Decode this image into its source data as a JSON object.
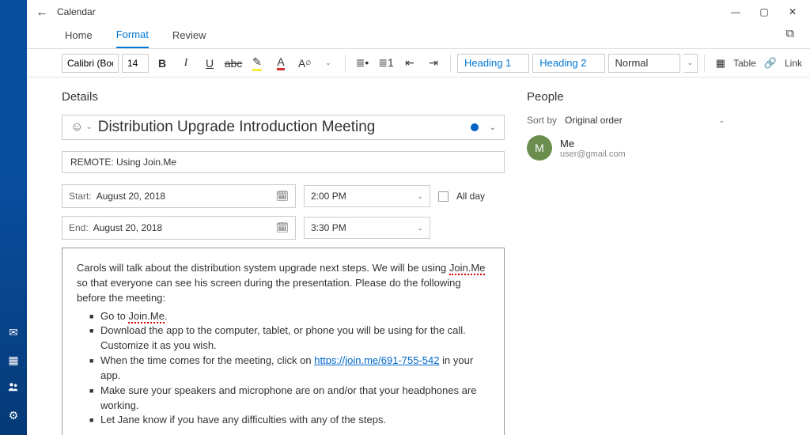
{
  "window": {
    "app_title": "Calendar"
  },
  "sidebar_icons": [
    "mail-icon",
    "calendar-icon",
    "people-icon",
    "settings-icon"
  ],
  "ribbon": {
    "tabs": [
      "Home",
      "Format",
      "Review"
    ],
    "active_tab": 1,
    "font_name": "Calibri (Body)",
    "font_size": "14",
    "heading1": "Heading 1",
    "heading2": "Heading 2",
    "normal": "Normal",
    "table_label": "Table",
    "link_label": "Link"
  },
  "details": {
    "section_label": "Details",
    "event_title": "Distribution Upgrade Introduction Meeting",
    "location": "REMOTE: Using Join.Me",
    "start_label": "Start:",
    "start_date": "August 20, 2018",
    "start_time": "2:00 PM",
    "all_day_label": "All day",
    "end_label": "End:",
    "end_date": "August 20, 2018",
    "end_time": "3:30 PM",
    "body_intro_1": "Carols will talk about the distribution system upgrade next steps. We will be using ",
    "body_intro_joinme": "Join.Me",
    "body_intro_2": " so that everyone can see his screen during the presentation. Please do the following before the meeting:",
    "bullets": {
      "b1a": "Go to ",
      "b1_link": "Join.Me",
      "b1b": ".",
      "b2": "Download the app to the computer, tablet, or phone you will be using for the call. Customize it as you wish.",
      "b3a": "When the time comes for the meeting, click on ",
      "b3_link": "https://join.me/691-755-542",
      "b3b": " in your app.",
      "b4": "Make sure your speakers and microphone are on and/or that your headphones are working.",
      "b5": "Let Jane know if you have any difficulties with any of the steps."
    }
  },
  "people": {
    "section_label": "People",
    "sort_label": "Sort by",
    "sort_value": "Original order",
    "me": {
      "initial": "M",
      "name": "Me",
      "email": "user@gmail.com"
    }
  }
}
